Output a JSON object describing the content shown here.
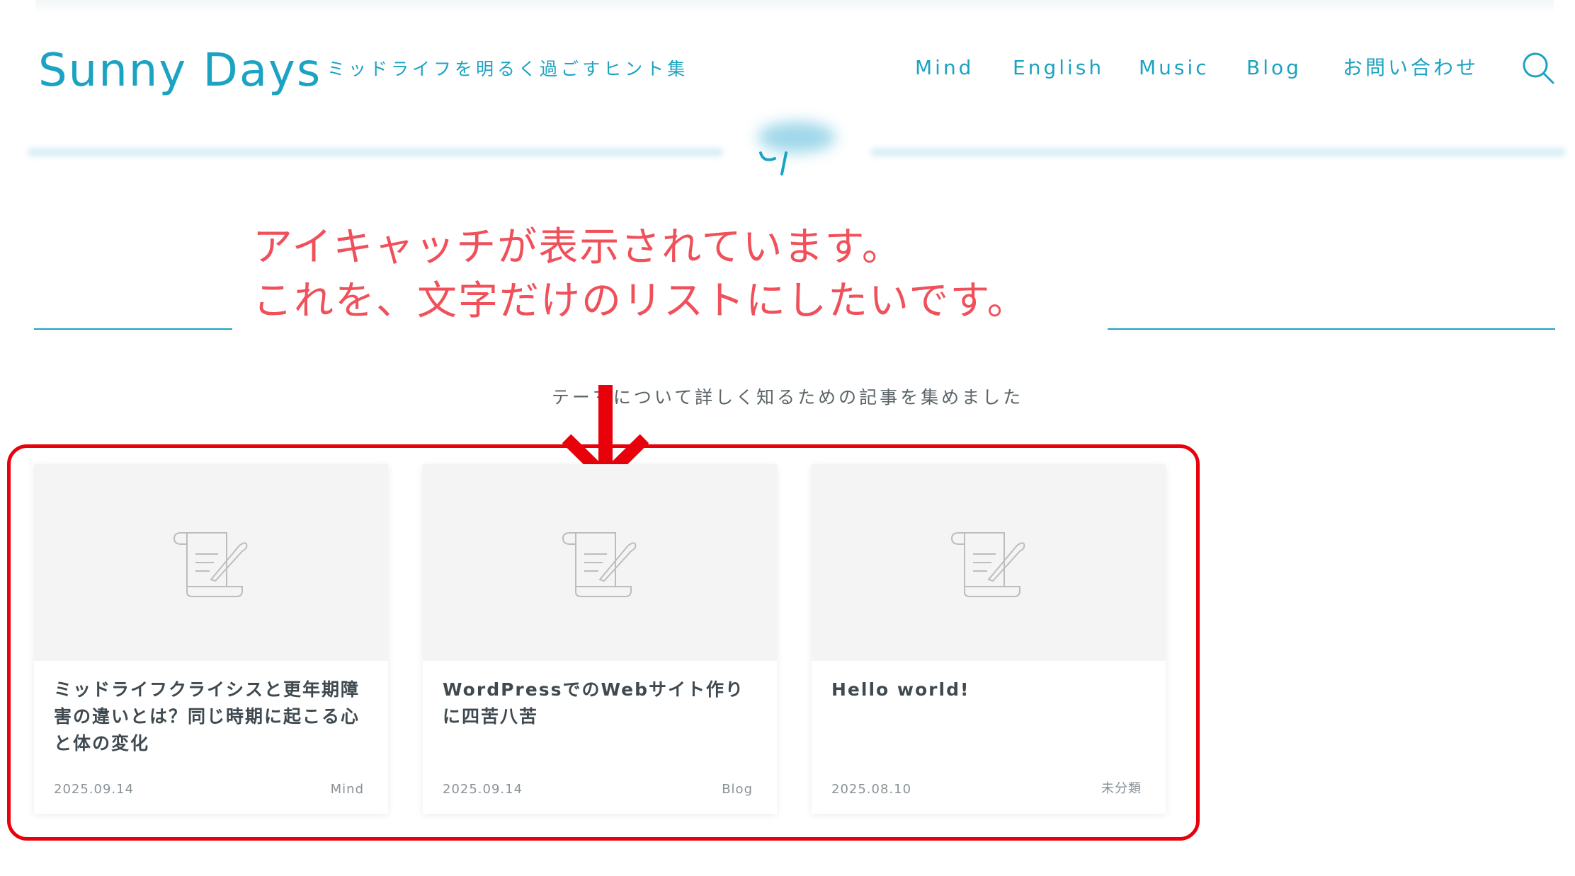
{
  "header": {
    "site_title": "Sunny Days",
    "tagline": "ミッドライフを明るく過ごすヒント集",
    "nav": [
      {
        "label": "Mind"
      },
      {
        "label": "English"
      },
      {
        "label": "Music"
      },
      {
        "label": "Blog"
      },
      {
        "label": "お問い合わせ"
      }
    ],
    "search_icon": "search-icon"
  },
  "annotation": {
    "line1": "アイキャッチが表示されています。",
    "line2": "これを、文字だけのリストにしたいです。"
  },
  "section": {
    "subtitle": "テーマについて詳しく知るための記事を集めました"
  },
  "posts": [
    {
      "title": "ミッドライフクライシスと更年期障害の違いとは？同じ時期に起こる心と体の変化",
      "date": "2025.09.14",
      "category": "Mind",
      "thumb_icon": "scroll-quill-icon"
    },
    {
      "title": "WordPressでのWebサイト作りに四苦八苦",
      "date": "2025.09.14",
      "category": "Blog",
      "thumb_icon": "scroll-quill-icon"
    },
    {
      "title": "Hello world!",
      "date": "2025.08.10",
      "category": "未分類",
      "thumb_icon": "scroll-quill-icon"
    }
  ],
  "colors": {
    "brand": "#1aa3c2",
    "annotation": "#f0505a",
    "highlight": "#e8000b",
    "thumb_bg": "#f4f4f4"
  }
}
